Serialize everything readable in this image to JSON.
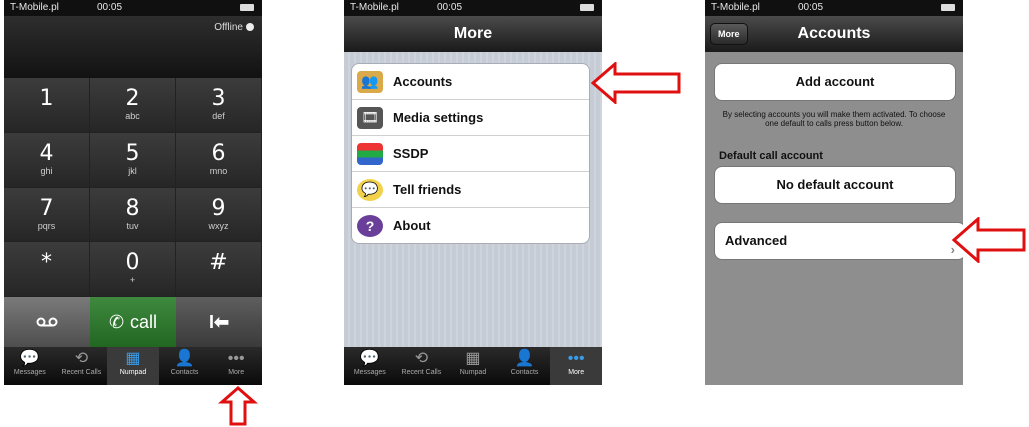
{
  "status": {
    "carrier": "T-Mobile.pl",
    "time": "00:05"
  },
  "dialer": {
    "offline_label": "Offline",
    "keys": [
      {
        "digit": "1",
        "letters": ""
      },
      {
        "digit": "2",
        "letters": "abc"
      },
      {
        "digit": "3",
        "letters": "def"
      },
      {
        "digit": "4",
        "letters": "ghi"
      },
      {
        "digit": "5",
        "letters": "jkl"
      },
      {
        "digit": "6",
        "letters": "mno"
      },
      {
        "digit": "7",
        "letters": "pqrs"
      },
      {
        "digit": "8",
        "letters": "tuv"
      },
      {
        "digit": "9",
        "letters": "wxyz"
      },
      {
        "digit": "*",
        "letters": ""
      },
      {
        "digit": "0",
        "letters": "+"
      },
      {
        "digit": "#",
        "letters": ""
      }
    ],
    "call_label": "call"
  },
  "tabs": [
    "Messages",
    "Recent Calls",
    "Numpad",
    "Contacts",
    "More"
  ],
  "more_screen": {
    "title": "More",
    "items": [
      "Accounts",
      "Media settings",
      "SSDP",
      "Tell friends",
      "About"
    ]
  },
  "accounts_screen": {
    "back_label": "More",
    "title": "Accounts",
    "add_account": "Add account",
    "note": "By selecting accounts you will make them activated. To choose one default to calls press button below.",
    "default_header": "Default call account",
    "no_default": "No default account",
    "advanced": "Advanced"
  },
  "colors": {
    "arrow": "#e01010",
    "call_green": "#2f7a2f",
    "active_tab": "#3a9be8"
  }
}
